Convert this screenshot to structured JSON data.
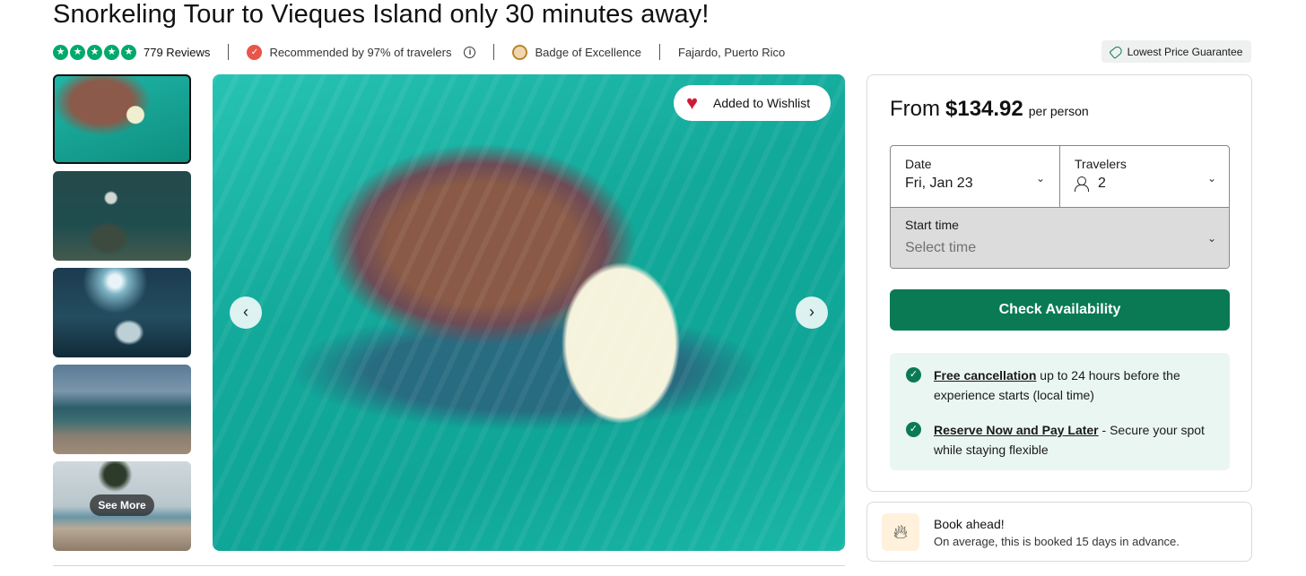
{
  "title": "Snorkeling Tour to Vieques Island only 30 minutes away!",
  "rating": {
    "stars": 5,
    "reviews_label": "779 Reviews"
  },
  "meta": {
    "recommended": "Recommended by 97% of travelers",
    "badge": "Badge of Excellence",
    "location": "Fajardo, Puerto Rico"
  },
  "lowest_price_label": "Lowest Price Guarantee",
  "gallery": {
    "see_more": "See More",
    "wishlist_label": "Added to Wishlist"
  },
  "booking": {
    "price_from": "From",
    "price_amount": "$134.92",
    "price_unit": "per person",
    "date_label": "Date",
    "date_value": "Fri, Jan 23",
    "travelers_label": "Travelers",
    "travelers_value": "2",
    "start_time_label": "Start time",
    "start_time_placeholder": "Select time",
    "check_button": "Check Availability",
    "policies": [
      {
        "link": "Free cancellation",
        "text": " up to 24 hours before the experience starts (local time)"
      },
      {
        "link": "Reserve Now and Pay Later",
        "text": " - Secure your spot while staying flexible"
      }
    ]
  },
  "book_ahead": {
    "title": "Book ahead!",
    "subtitle": "On average, this is booked 15 days in advance."
  },
  "colors": {
    "accent": "#0a7a55",
    "star": "#00aa6c",
    "heart": "#d0193a"
  },
  "icons": [
    "star-icon",
    "recommend-icon",
    "info-icon",
    "badge-icon",
    "tag-icon",
    "heart-icon",
    "chevron-left-icon",
    "chevron-right-icon",
    "chevron-down-icon",
    "person-icon",
    "check-circle-icon",
    "flame-icon"
  ]
}
